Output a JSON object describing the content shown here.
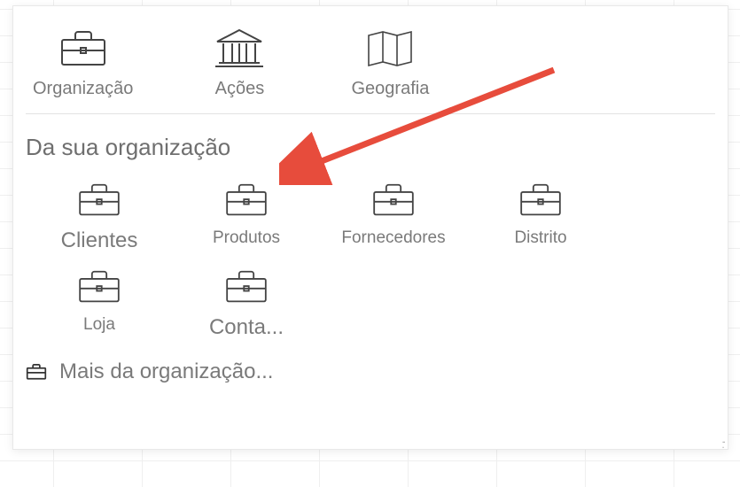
{
  "topCategories": [
    {
      "id": "organizacao",
      "label": "Organização",
      "icon": "briefcase"
    },
    {
      "id": "acoes",
      "label": "Ações",
      "icon": "bank"
    },
    {
      "id": "geografia",
      "label": "Geografia",
      "icon": "map"
    }
  ],
  "section": {
    "title": "Da sua organização",
    "items": [
      {
        "id": "clientes",
        "label": "Clientes",
        "icon": "briefcase"
      },
      {
        "id": "produtos",
        "label": "Produtos",
        "icon": "briefcase"
      },
      {
        "id": "fornecedores",
        "label": "Fornecedores",
        "icon": "briefcase"
      },
      {
        "id": "distrito",
        "label": "Distrito",
        "icon": "briefcase"
      },
      {
        "id": "loja",
        "label": "Loja",
        "icon": "briefcase"
      },
      {
        "id": "conta",
        "label": "Conta...",
        "icon": "briefcase"
      }
    ]
  },
  "more": {
    "label": "Mais da organização...",
    "icon": "briefcase-small"
  },
  "annotation": {
    "arrow_color": "#E74C3C"
  }
}
